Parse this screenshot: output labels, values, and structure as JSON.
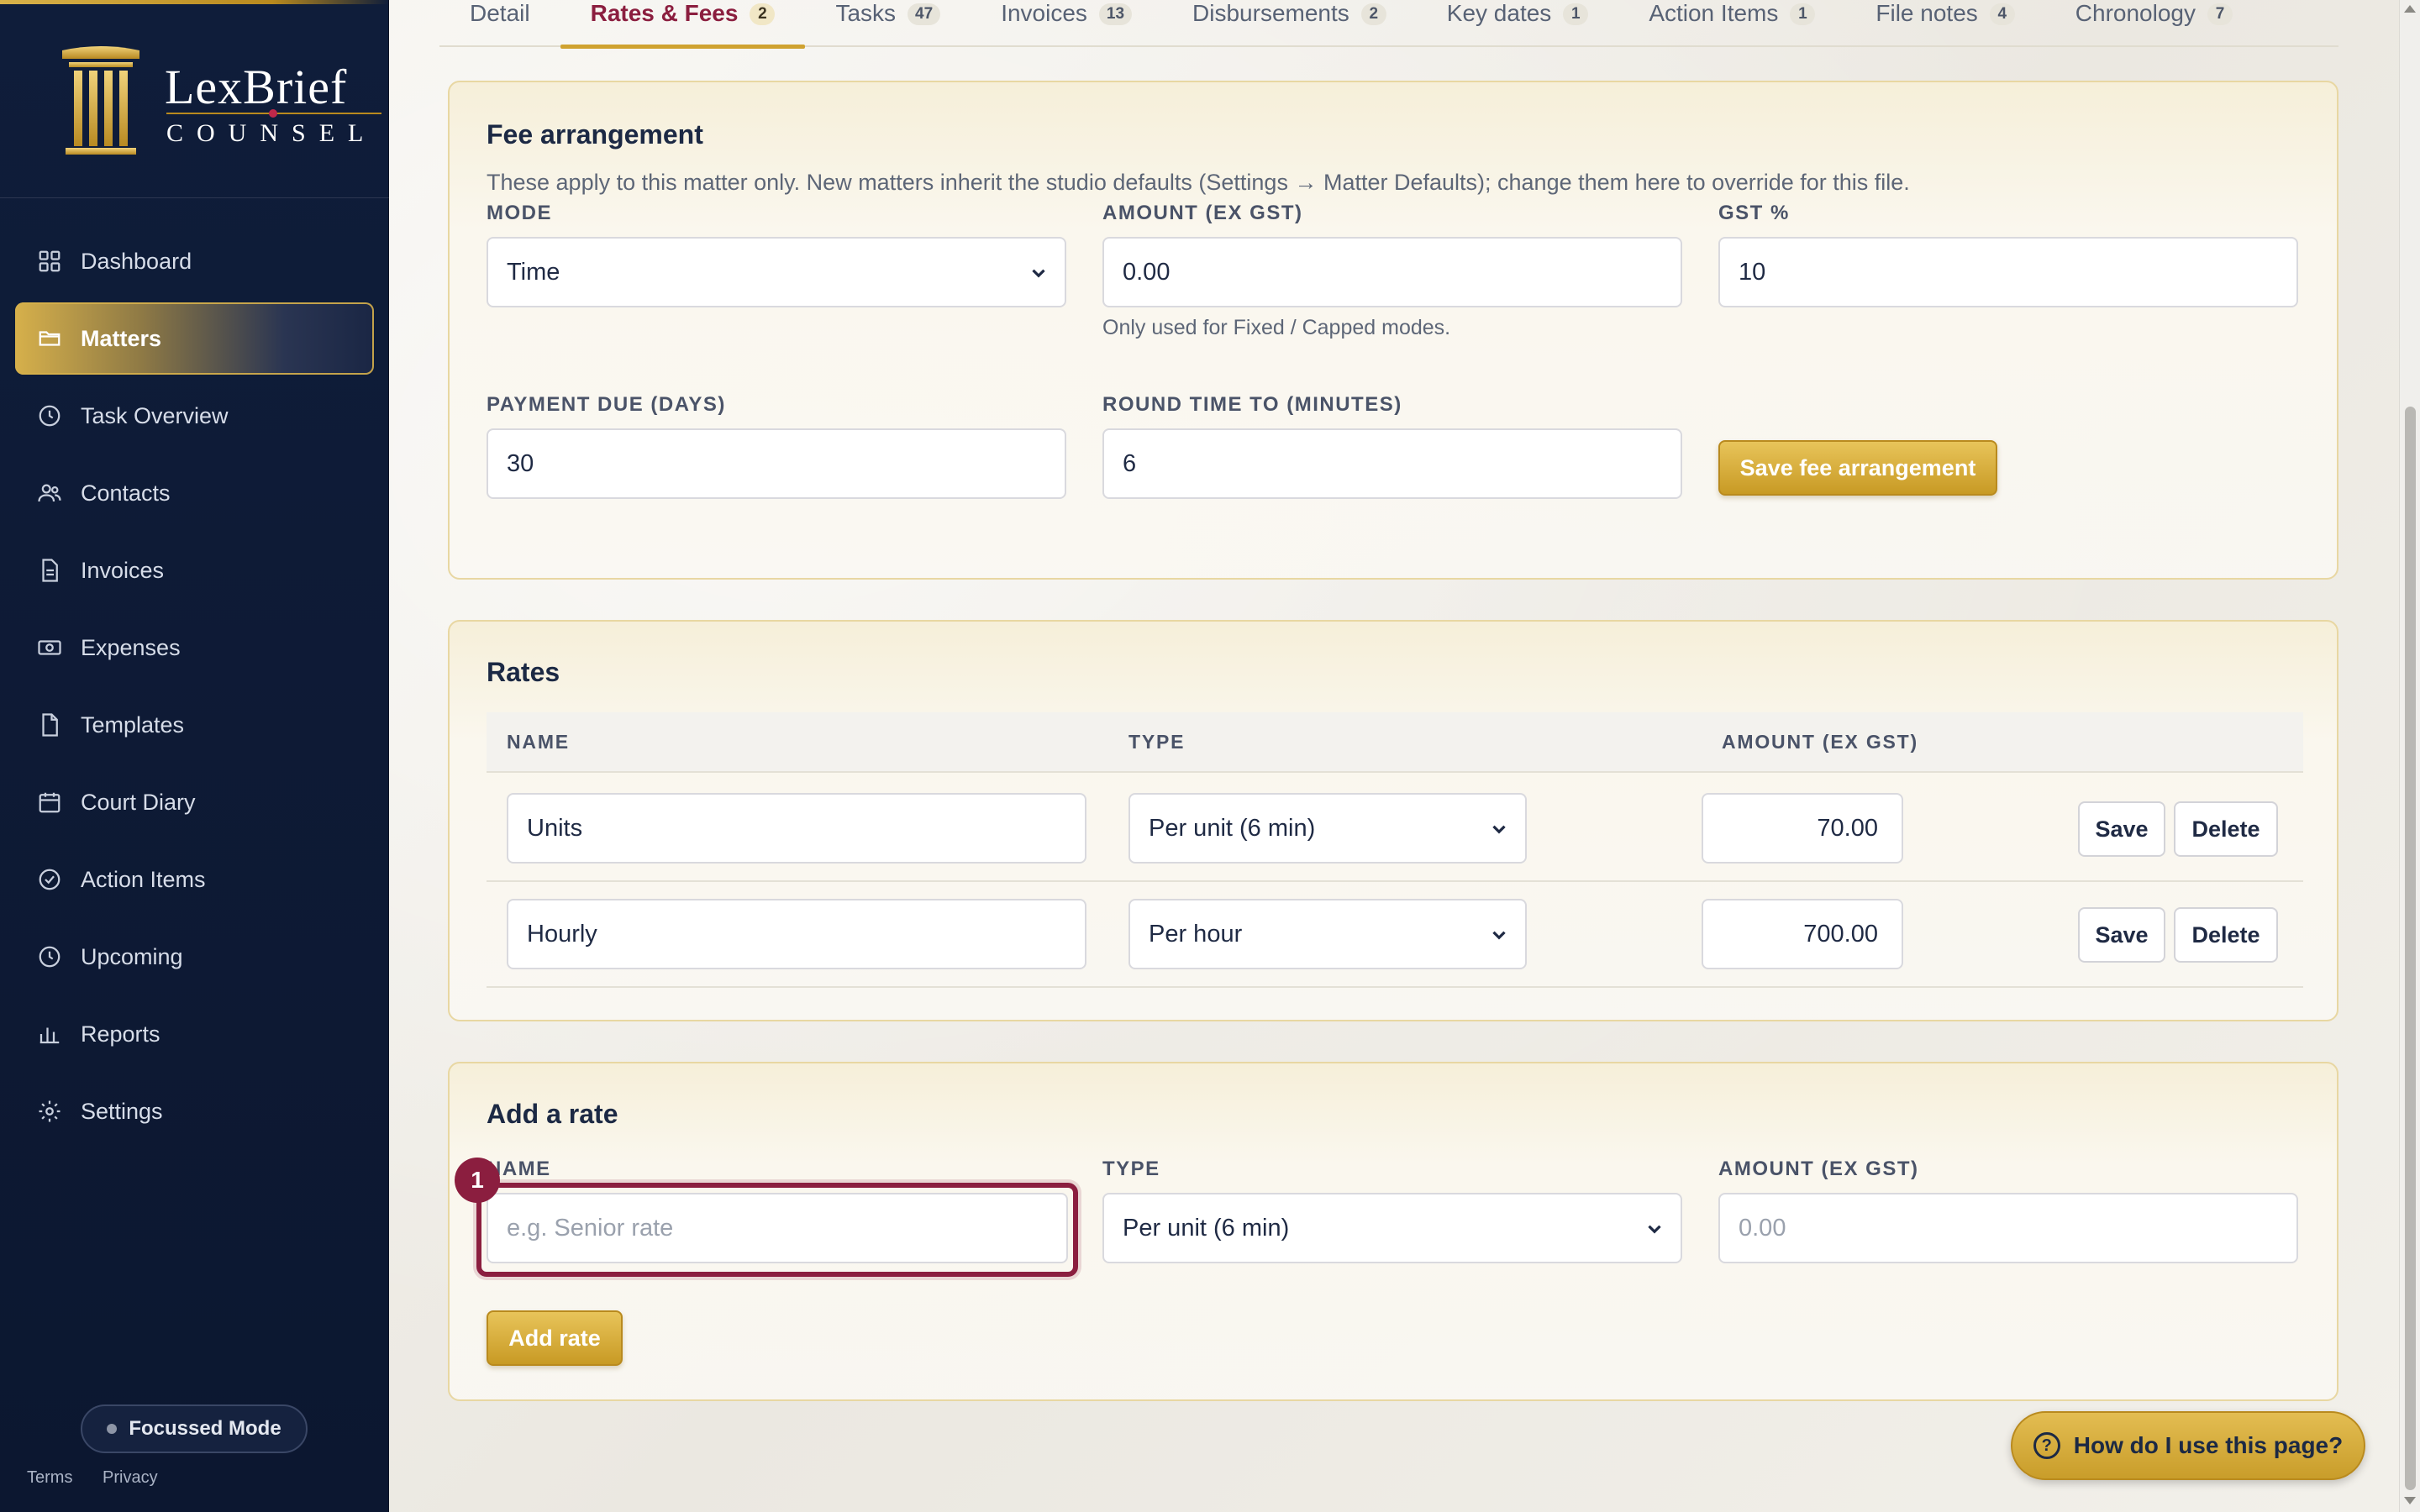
{
  "brand": {
    "name": "LexBrief",
    "subtitle": "COUNSEL"
  },
  "sidebar": {
    "items": [
      {
        "label": "Dashboard",
        "icon": "grid-icon"
      },
      {
        "label": "Matters",
        "icon": "folder-icon",
        "active": true
      },
      {
        "label": "Task Overview",
        "icon": "clock-icon"
      },
      {
        "label": "Contacts",
        "icon": "users-icon"
      },
      {
        "label": "Invoices",
        "icon": "file-text-icon"
      },
      {
        "label": "Expenses",
        "icon": "banknote-icon"
      },
      {
        "label": "Templates",
        "icon": "file-icon"
      },
      {
        "label": "Court Diary",
        "icon": "calendar-icon"
      },
      {
        "label": "Action Items",
        "icon": "check-circle-icon"
      },
      {
        "label": "Upcoming",
        "icon": "clock-icon"
      },
      {
        "label": "Reports",
        "icon": "bar-chart-icon"
      },
      {
        "label": "Settings",
        "icon": "gear-icon"
      }
    ],
    "focus_mode_label": "Focussed Mode",
    "terms": "Terms",
    "privacy": "Privacy"
  },
  "tabs": [
    {
      "label": "Detail",
      "count": ""
    },
    {
      "label": "Rates & Fees",
      "count": "2",
      "active": true
    },
    {
      "label": "Tasks",
      "count": "47"
    },
    {
      "label": "Invoices",
      "count": "13"
    },
    {
      "label": "Disbursements",
      "count": "2"
    },
    {
      "label": "Key dates",
      "count": "1"
    },
    {
      "label": "Action Items",
      "count": "1"
    },
    {
      "label": "File notes",
      "count": "4"
    },
    {
      "label": "Chronology",
      "count": "7"
    }
  ],
  "fee": {
    "title": "Fee arrangement",
    "hint": "These apply to this matter only. New matters inherit the studio defaults (Settings → Matter Defaults); change them here to override for this file.",
    "mode_label": "MODE",
    "mode_value": "Time",
    "amount_label": "AMOUNT (EX GST)",
    "amount_value": "0.00",
    "amount_hint": "Only used for Fixed / Capped modes.",
    "gst_label": "GST %",
    "gst_value": "10",
    "due_label": "PAYMENT DUE (DAYS)",
    "due_value": "30",
    "round_label": "ROUND TIME TO (MINUTES)",
    "round_value": "6",
    "save_label": "Save fee arrangement"
  },
  "rates": {
    "title": "Rates",
    "col_name": "NAME",
    "col_type": "TYPE",
    "col_amount": "AMOUNT (EX GST)",
    "rows": [
      {
        "name": "Units",
        "type": "Per unit (6 min)",
        "amount": "70.00"
      },
      {
        "name": "Hourly",
        "type": "Per hour",
        "amount": "700.00"
      }
    ],
    "save_label": "Save",
    "delete_label": "Delete"
  },
  "add_rate": {
    "title": "Add a rate",
    "name_label": "NAME",
    "name_placeholder": "e.g. Senior rate",
    "type_label": "TYPE",
    "type_value": "Per unit (6 min)",
    "amount_label": "AMOUNT (EX GST)",
    "amount_placeholder": "0.00",
    "button_label": "Add rate",
    "step": "1"
  },
  "help_label": "How do I use this page?",
  "colors": {
    "accent": "#8b1e3f",
    "gold": "#cfa230",
    "sidebar": "#0f1d3a"
  }
}
